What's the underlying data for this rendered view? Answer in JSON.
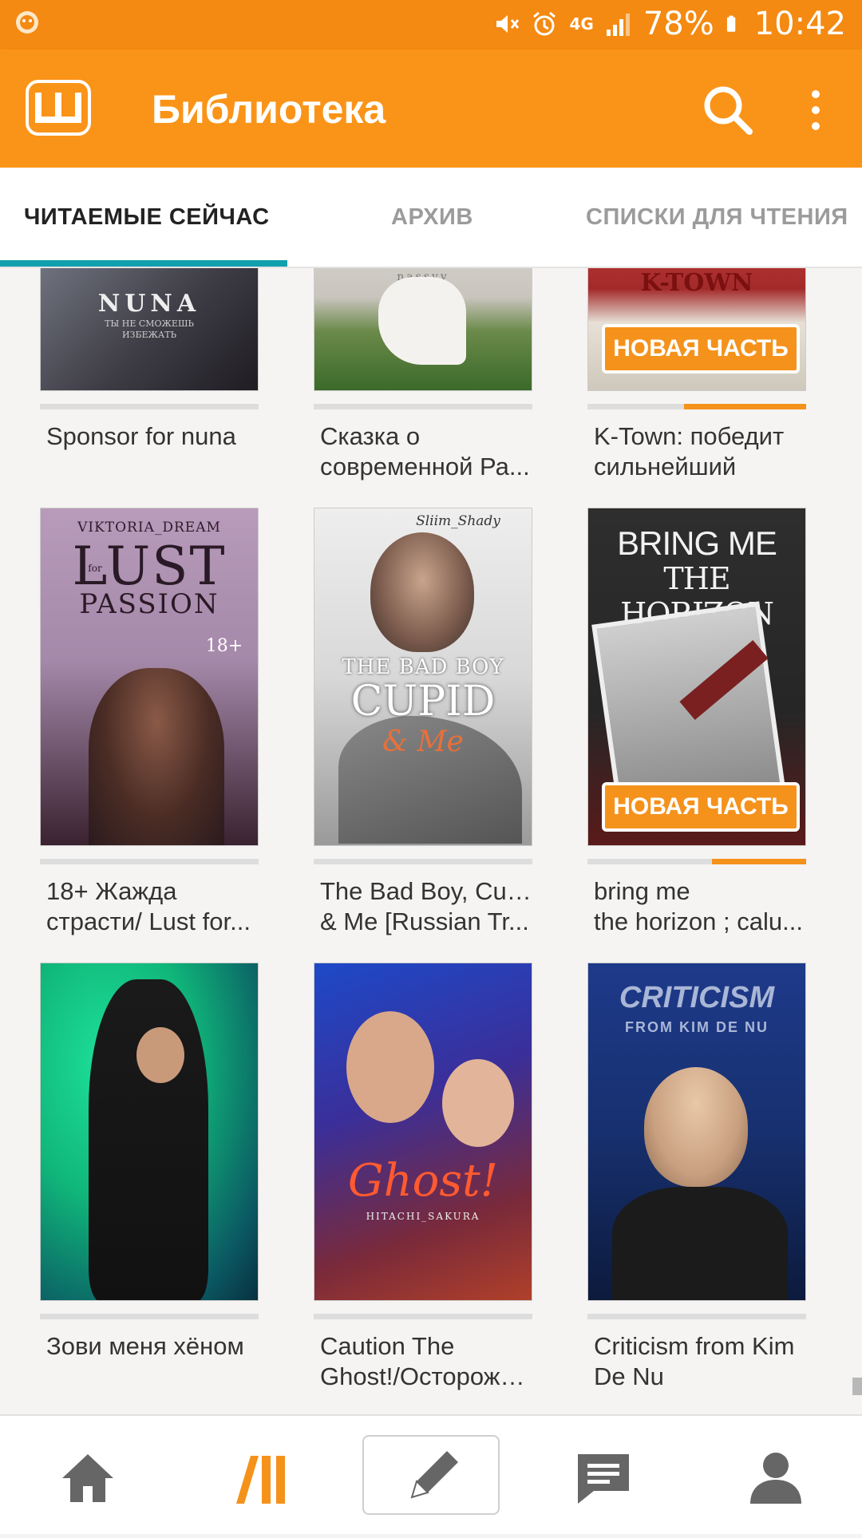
{
  "status_bar": {
    "battery": "78%",
    "time": "10:42",
    "network": "4G",
    "icons": [
      "wattpad-notification-icon",
      "mute-icon",
      "alarm-icon",
      "signal-icon",
      "battery-icon"
    ]
  },
  "app_bar": {
    "title": "Библиотека",
    "logo_letter": "Ш",
    "icons": [
      "search-icon",
      "more-vert-icon"
    ]
  },
  "tabs": [
    {
      "label": "ЧИТАЕМЫЕ СЕЙЧАС",
      "active": true
    },
    {
      "label": "АРХИВ",
      "active": false
    },
    {
      "label": "СПИСКИ ДЛЯ ЧТЕНИЯ",
      "active": false
    }
  ],
  "books": [
    {
      "title": [
        "Sponsor for nuna"
      ],
      "cover_text": [
        "NUNA",
        "ТЫ НЕ СМОЖЕШЬ",
        "ИЗБЕЖАТЬ"
      ],
      "cover_colors": [
        "#6a6f7a",
        "#2c2b30"
      ],
      "progress": 0,
      "new_part": false
    },
    {
      "title": [
        "Сказка о",
        "современной Ра..."
      ],
      "cover_text": [
        "nassyy"
      ],
      "cover_colors": [
        "#9aa587",
        "#3f6b2c"
      ],
      "progress": 0,
      "new_part": false
    },
    {
      "title": [
        "K-Town: победит",
        "сильнейший"
      ],
      "cover_text": [
        "K-TOWN"
      ],
      "cover_colors": [
        "#b83535",
        "#d9d3c8"
      ],
      "progress": 0.56,
      "new_part": true,
      "badge": "НОВАЯ ЧАСТЬ"
    },
    {
      "title": [
        "18+ Жажда",
        "страсти/ Lust for..."
      ],
      "cover_text": [
        "VIKTORIA_DREAM",
        "LUST",
        "for",
        "PASSION",
        "18+"
      ],
      "cover_colors": [
        "#b79ab8",
        "#3a2230"
      ],
      "progress": 0,
      "new_part": false
    },
    {
      "title": [
        "The Bad Boy, Cupid",
        "& Me [Russian Tr..."
      ],
      "cover_text": [
        "Sliim_Shady",
        "THE BAD BOY",
        "CUPID",
        "& Me"
      ],
      "cover_colors": [
        "#f2f2f2",
        "#555555"
      ],
      "progress": 0,
      "new_part": false
    },
    {
      "title": [
        "bring me",
        "the horizon ; calu..."
      ],
      "cover_text": [
        "BRING ME",
        "THE HORIZON"
      ],
      "cover_colors": [
        "#2b2b2b",
        "#7a1d1d"
      ],
      "progress": 0.43,
      "new_part": true,
      "badge": "НОВАЯ ЧАСТЬ"
    },
    {
      "title": [
        "Зови меня хёном"
      ],
      "cover_text": [],
      "cover_colors": [
        "#14d18a",
        "#0a3a4a"
      ],
      "progress": 0,
      "new_part": false
    },
    {
      "title": [
        "Caution The",
        "Ghost!/Осторожно..."
      ],
      "cover_text": [
        "Ghost!",
        "HITACHI_SAKURA"
      ],
      "cover_colors": [
        "#263fa8",
        "#8a2d2a"
      ],
      "progress": 0,
      "new_part": false
    },
    {
      "title": [
        "Criticism from Kim",
        "De Nu"
      ],
      "cover_text": [
        "CRITICISM",
        "FROM KIM DE NU"
      ],
      "cover_colors": [
        "#1e3a8a",
        "#0c1a3c"
      ],
      "progress": 0,
      "new_part": false
    }
  ],
  "bottom_nav": [
    "home-icon",
    "library-icon",
    "write-icon",
    "messages-icon",
    "profile-icon"
  ],
  "colors": {
    "accent": "#fa9418",
    "tab_indicator": "#129fae",
    "badge": "#f5921b"
  }
}
